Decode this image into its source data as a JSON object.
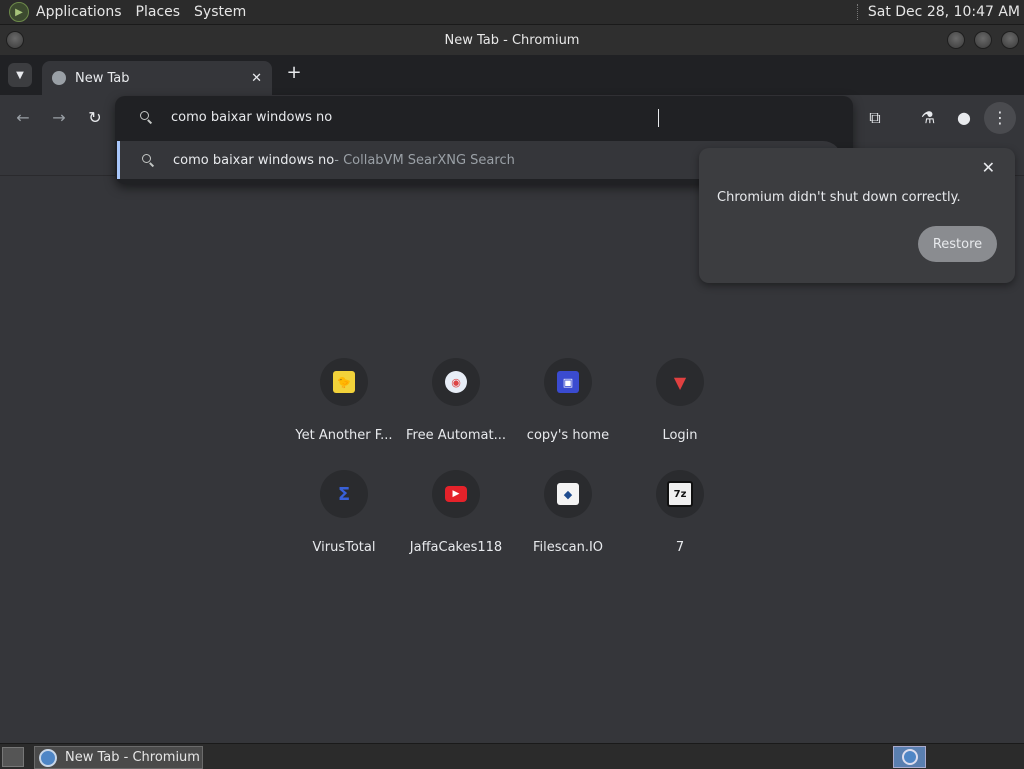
{
  "top_panel": {
    "menus": [
      "Applications",
      "Places",
      "System"
    ],
    "clock": "Sat Dec 28, 10:47 AM"
  },
  "window": {
    "title": "New Tab - Chromium"
  },
  "tabs": [
    {
      "label": "New Tab"
    }
  ],
  "omnibox": {
    "input_value": "como baixar windows no",
    "suggestion": {
      "query": "como baixar windows no",
      "source": " - CollabVM SearXNG Search"
    }
  },
  "restore_bubble": {
    "message": "Chromium didn't shut down correctly.",
    "button": "Restore"
  },
  "shortcuts": [
    {
      "label": "Yet Another F...",
      "icon": "yellow-duck-icon"
    },
    {
      "label": "Free Automat...",
      "icon": "automation-globe-icon"
    },
    {
      "label": "copy's home",
      "icon": "pixel-creature-icon"
    },
    {
      "label": "Login",
      "icon": "red-wing-icon"
    },
    {
      "label": "VirusTotal",
      "icon": "virustotal-icon"
    },
    {
      "label": "JaffaCakes118",
      "icon": "youtube-icon"
    },
    {
      "label": "Filescan.IO",
      "icon": "owl-icon"
    },
    {
      "label": "7",
      "icon": "7zip-icon"
    }
  ],
  "taskbar": {
    "task_label": "New Tab - Chromium"
  },
  "colors": {
    "page_bg": "#35363a",
    "omnibox_bg": "#202124",
    "accent": "#a8c7fa"
  }
}
